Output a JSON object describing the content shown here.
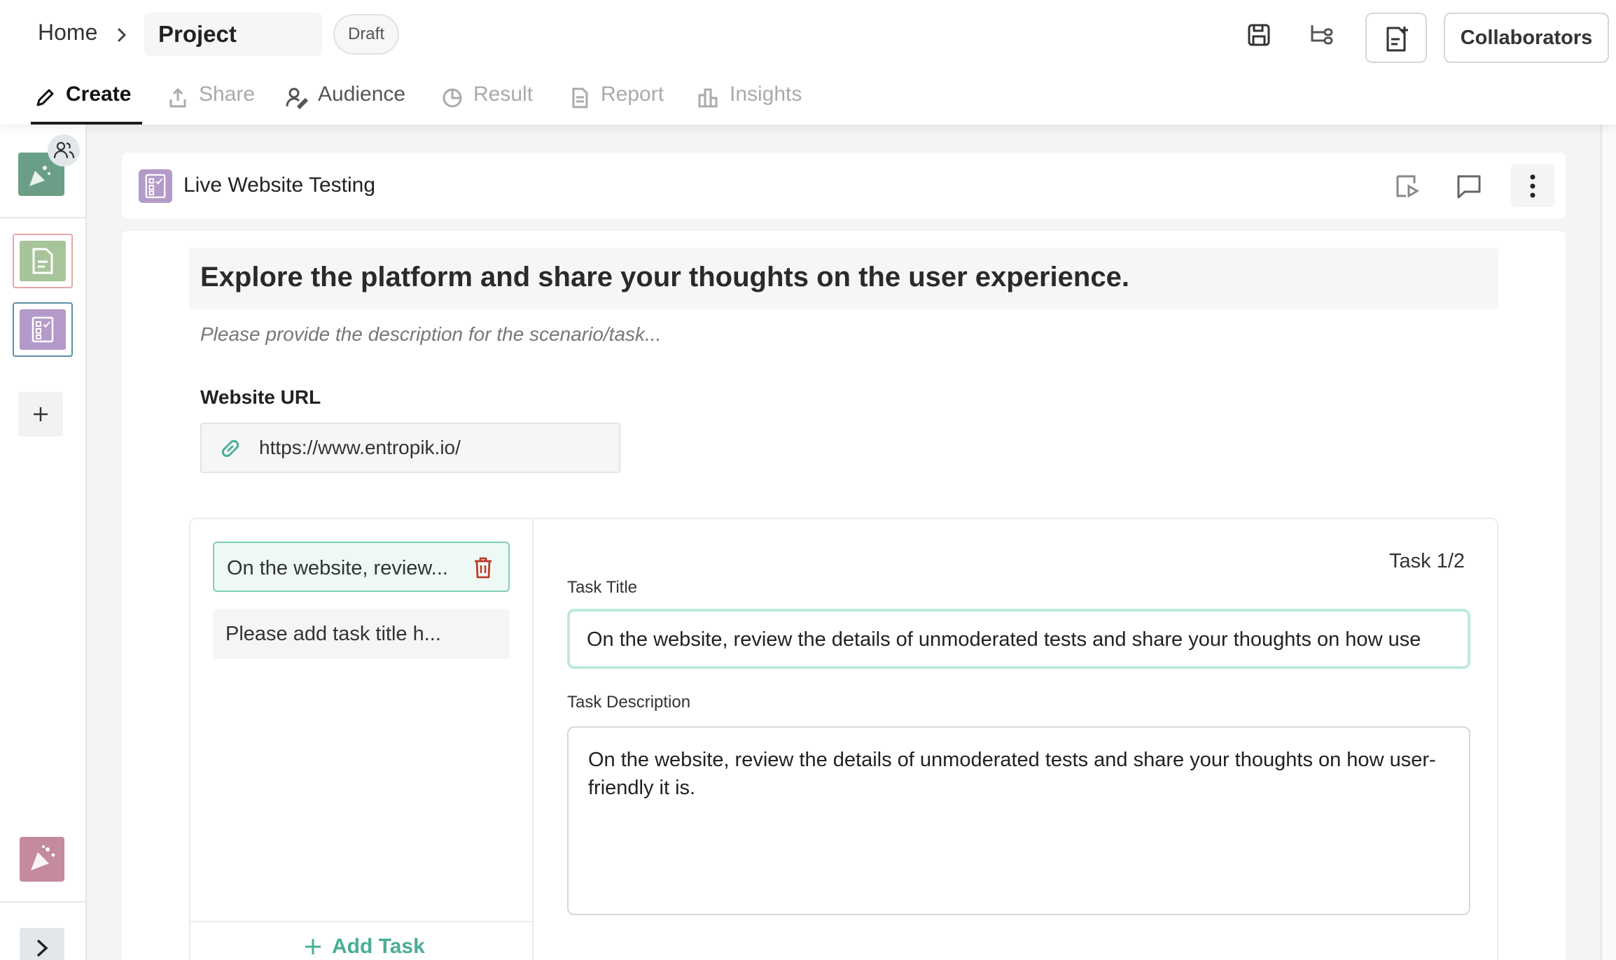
{
  "breadcrumb": {
    "home": "Home",
    "project": "Project"
  },
  "status_badge": "Draft",
  "header_actions": {
    "collaborators_label": "Collaborators"
  },
  "tabs": [
    {
      "label": "Create",
      "state": "active"
    },
    {
      "label": "Share",
      "state": "disabled"
    },
    {
      "label": "Audience",
      "state": "enabled"
    },
    {
      "label": "Result",
      "state": "disabled"
    },
    {
      "label": "Report",
      "state": "disabled"
    },
    {
      "label": "Insights",
      "state": "disabled"
    }
  ],
  "block": {
    "title": "Live Website Testing"
  },
  "question": {
    "title": "Explore the platform and share your thoughts on the user experience.",
    "description_placeholder": "Please provide the description for the scenario/task..."
  },
  "website": {
    "label": "Website URL",
    "url": "https://www.entropik.io/"
  },
  "tasks": {
    "items": [
      {
        "label": "On the website, review..."
      },
      {
        "label": "Please add task title h..."
      }
    ],
    "add_label": "Add Task",
    "counter": "Task 1/2",
    "title_label": "Task Title",
    "title_value": "On the website, review the details of unmoderated tests and share your thoughts on how use",
    "description_label": "Task Description",
    "description_value": "On the website, review the details of unmoderated tests and share your thoughts on how user-friendly it is."
  },
  "colors": {
    "accent": "#4aae96",
    "selected_border": "#7ccfb9",
    "block_icon": "#b49ac9",
    "delete": "#c0392b"
  }
}
